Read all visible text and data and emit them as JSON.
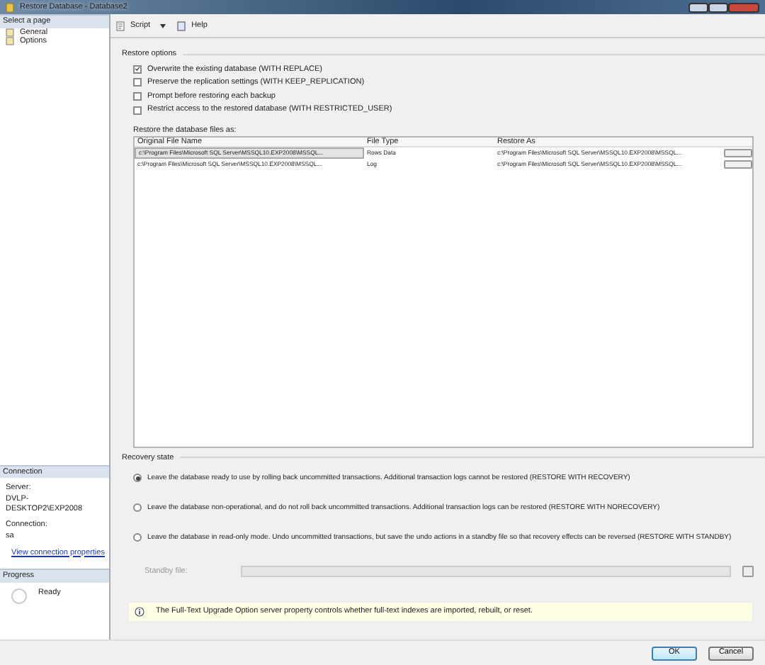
{
  "window": {
    "title": "Restore Database - Database2"
  },
  "sidebar": {
    "header": "Select a page",
    "items": [
      {
        "label": "General"
      },
      {
        "label": "Options"
      }
    ]
  },
  "toolbar": [
    {
      "label": "Script",
      "kind": "dropdown"
    },
    {
      "label": "Help",
      "kind": "button"
    }
  ],
  "restore_options": {
    "title": "Restore options",
    "options": [
      {
        "label": "Overwrite the existing database (WITH REPLACE)",
        "checked": true
      },
      {
        "label": "Preserve the replication settings (WITH KEEP_REPLICATION)",
        "checked": false
      },
      {
        "label": "Prompt before restoring each backup",
        "checked": false
      },
      {
        "label": "Restrict access to the restored database (WITH RESTRICTED_USER)",
        "checked": false
      }
    ],
    "files_label": "Restore the database files as:",
    "columns": [
      "Original File Name",
      "File Type",
      "Restore As"
    ],
    "rows": [
      {
        "original": "c:\\Program Files\\Microsoft SQL Server\\MSSQL10.EXP2008\\MSSQL...",
        "type": "Rows Data",
        "restore_as": "c:\\Program Files\\Microsoft SQL Server\\MSSQL10.EXP2008\\MSSQL...",
        "selected": true
      },
      {
        "original": "c:\\Program Files\\Microsoft SQL Server\\MSSQL10.EXP2008\\MSSQL...",
        "type": "Log",
        "restore_as": "c:\\Program Files\\Microsoft SQL Server\\MSSQL10.EXP2008\\MSSQL...",
        "selected": false
      }
    ]
  },
  "recovery_state": {
    "title": "Recovery state",
    "options": [
      {
        "label": "Leave the database ready to use by rolling back uncommitted transactions. Additional transaction logs cannot be restored (RESTORE WITH RECOVERY)",
        "selected": true
      },
      {
        "label": "Leave the database non-operational, and do not roll back uncommitted transactions. Additional transaction logs can be restored (RESTORE WITH NORECOVERY)",
        "selected": false
      },
      {
        "label": "Leave the database in read-only mode. Undo uncommitted transactions, but save the undo actions in a standby file so that recovery effects can be reversed (RESTORE WITH STANDBY)",
        "selected": false
      }
    ],
    "standby_label": "Standby file:",
    "standby_disabled": true
  },
  "connection": {
    "title": "Connection",
    "server_label": "Server:",
    "server": "DVLP-DESKTOP2\\EXP2008",
    "connection_label": "Connection:",
    "connection": "sa",
    "link": "View connection properties"
  },
  "progress": {
    "title": "Progress",
    "status": "Ready"
  },
  "info": "The Full-Text Upgrade Option server property controls whether full-text indexes are imported, rebuilt, or reset.",
  "buttons": [
    "OK",
    "Cancel"
  ]
}
